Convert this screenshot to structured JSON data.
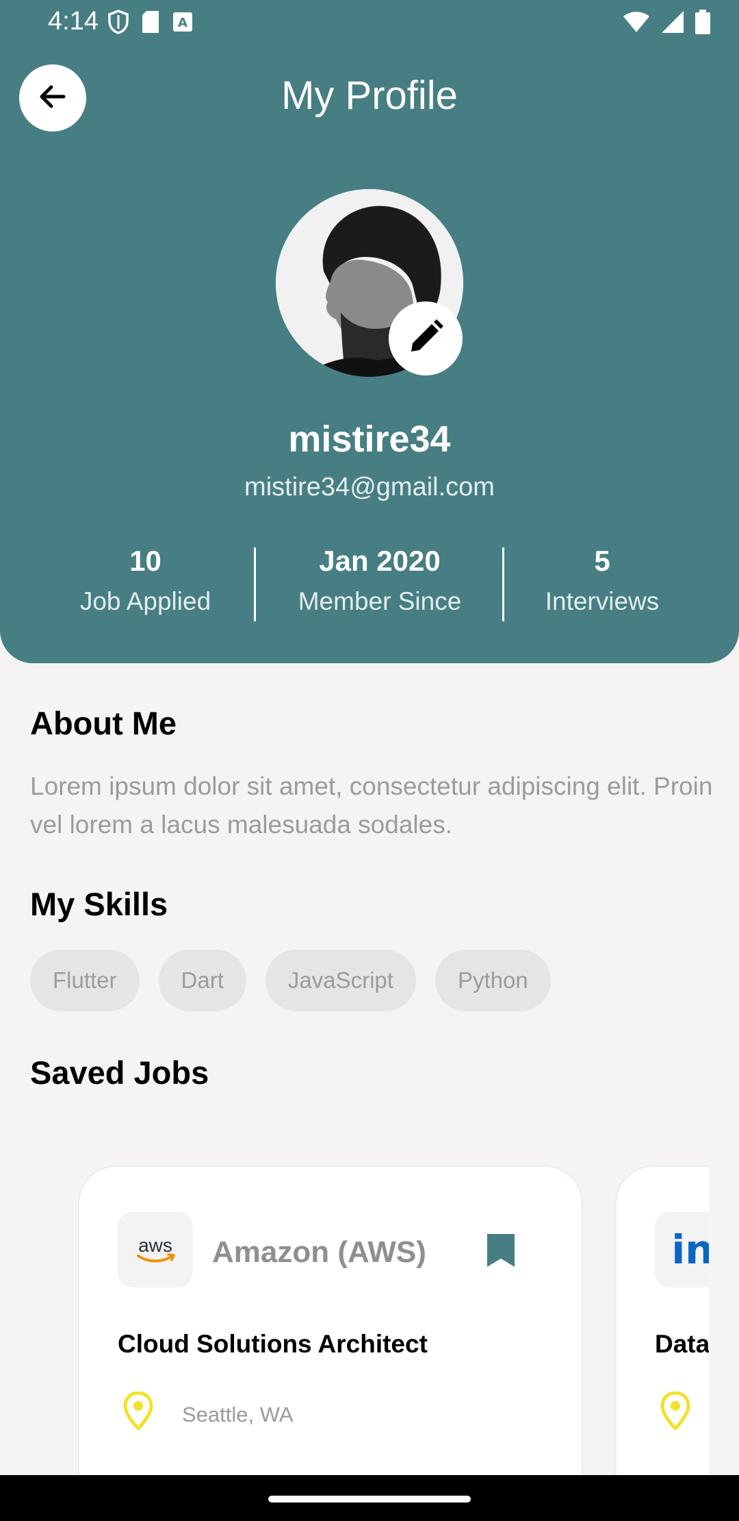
{
  "status_bar": {
    "time": "4:14",
    "icons_left": [
      "shield-icon",
      "sd-card-icon",
      "keyboard-a-icon"
    ],
    "icons_right": [
      "wifi-icon",
      "signal-icon",
      "battery-icon"
    ]
  },
  "header": {
    "title": "My Profile",
    "background_color": "#467e83",
    "username": "mistire34",
    "email": "mistire34@gmail.com",
    "stats": [
      {
        "value": "10",
        "label": "Job Applied"
      },
      {
        "value": "Jan 2020",
        "label": "Member Since"
      },
      {
        "value": "5",
        "label": "Interviews"
      }
    ]
  },
  "about": {
    "heading": "About Me",
    "text": "Lorem ipsum dolor sit amet, consectetur adipiscing elit. Proin vel lorem a lacus malesuada sodales."
  },
  "skills": {
    "heading": "My Skills",
    "items": [
      "Flutter",
      "Dart",
      "JavaScript",
      "Python"
    ]
  },
  "saved_jobs": {
    "heading": "Saved Jobs",
    "cards": [
      {
        "company": "Amazon (AWS)",
        "logo_text": "aws",
        "title": "Cloud Solutions Architect",
        "location": "Seattle, WA",
        "bookmarked": true
      },
      {
        "company": "",
        "logo_text": "in",
        "title": "Data",
        "location": "",
        "bookmarked": false
      }
    ]
  },
  "colors": {
    "accent": "#467e83",
    "location_pin": "#f2e22a",
    "linkedin": "#0a66c2",
    "aws_arrow": "#f29100"
  }
}
